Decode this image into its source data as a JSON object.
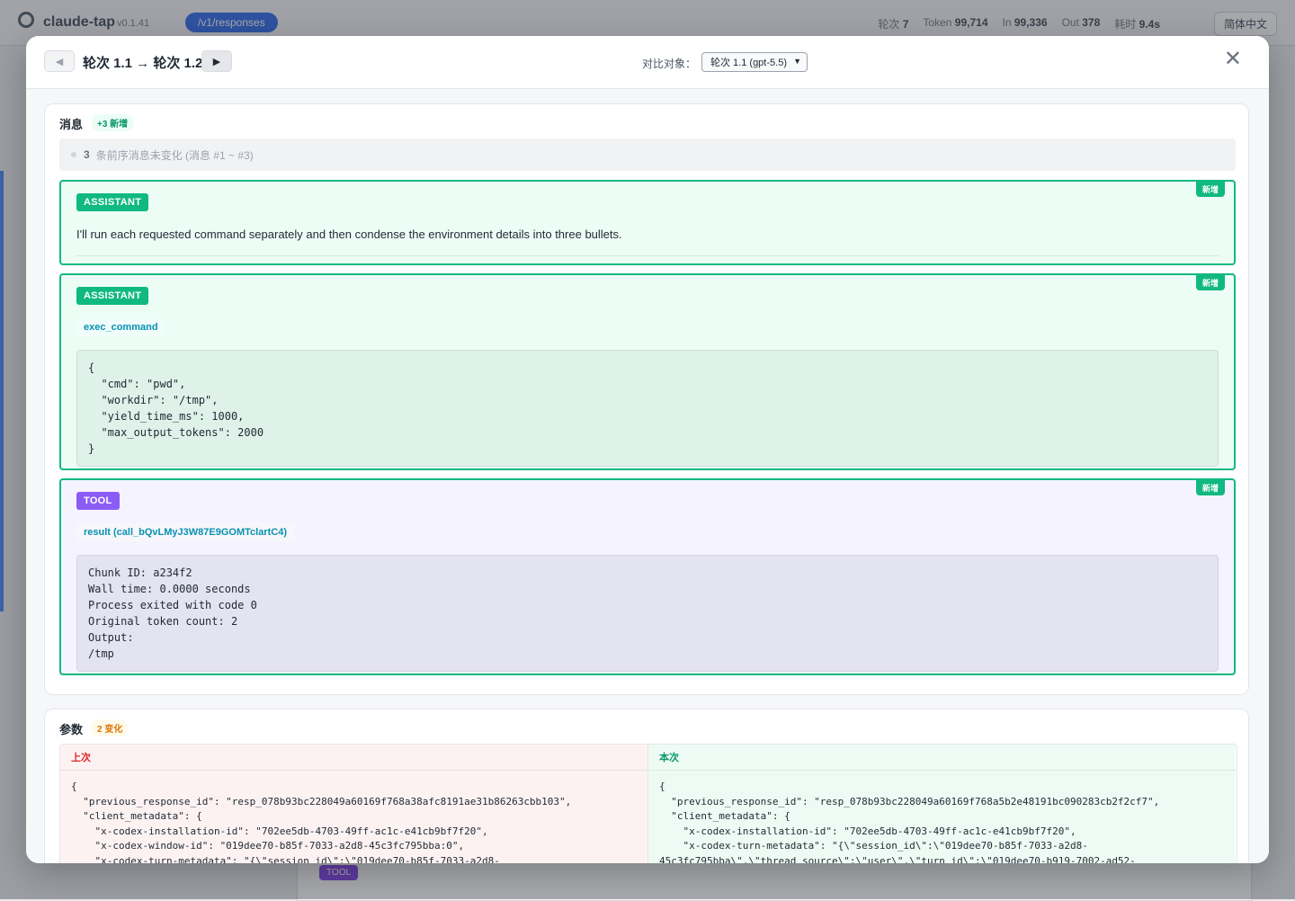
{
  "background": {
    "app_name": "claude-tap",
    "version": "v0.1.41",
    "endpoint_pill": "/v1/responses",
    "stats": [
      {
        "label": "轮次",
        "value": "7"
      },
      {
        "label": "Token",
        "value": "99,714"
      },
      {
        "label": "In",
        "value": "99,336"
      },
      {
        "label": "Out",
        "value": "378"
      },
      {
        "label": "耗时",
        "value": "9.4s"
      }
    ],
    "language": "简体中文",
    "tool_chip": "TOOL"
  },
  "modal": {
    "round_title": "轮次 1.1 → 轮次 1.2",
    "compare_label": "对比对象：",
    "compare_value": "轮次 1.1 (gpt-5.5)",
    "close_symbol": "✕",
    "prev_symbol": "◀",
    "next_symbol": "▶"
  },
  "messages": {
    "title": "消息",
    "badge": "+3 新增",
    "collapsed": {
      "count": "3",
      "text": "条前序消息未变化 (消息 #1 ~ #3)"
    },
    "new_tag": "新增",
    "items": [
      {
        "role": "ASSISTANT",
        "text": "I'll run each requested command separately and then condense the environment details into three bullets."
      },
      {
        "role": "ASSISTANT",
        "function": "exec_command",
        "code": "{\n  \"cmd\": \"pwd\",\n  \"workdir\": \"/tmp\",\n  \"yield_time_ms\": 1000,\n  \"max_output_tokens\": 2000\n}"
      },
      {
        "role": "TOOL",
        "function": "result (call_bQvLMyJ3W87E9GOMTclartC4)",
        "code": "Chunk ID: a234f2\nWall time: 0.0000 seconds\nProcess exited with code 0\nOriginal token count: 2\nOutput:\n/tmp"
      }
    ]
  },
  "params": {
    "title": "参数",
    "badge": "2 变化",
    "left_label": "上次",
    "right_label": "本次",
    "left_code": "{\n  \"previous_response_id\": \"resp_078b93bc228049a60169f768a38afc8191ae31b86263cbb103\",\n  \"client_metadata\": {\n    \"x-codex-installation-id\": \"702ee5db-4703-49ff-ac1c-e41cb9bf7f20\",\n    \"x-codex-window-id\": \"019dee70-b85f-7033-a2d8-45c3fc795bba:0\",\n    \"x-codex-turn-metadata\": \"{\\\"session_id\\\":\\\"019dee70-b85f-7033-a2d8-",
    "right_code": "{\n  \"previous_response_id\": \"resp_078b93bc228049a60169f768a5b2e48191bc090283cb2f2cf7\",\n  \"client_metadata\": {\n    \"x-codex-installation-id\": \"702ee5db-4703-49ff-ac1c-e41cb9bf7f20\",\n    \"x-codex-turn-metadata\": \"{\\\"session_id\\\":\\\"019dee70-b85f-7033-a2d8-\n45c3fc795bba\\\",\\\"thread_source\\\":\\\"user\\\",\\\"turn_id\\\":\\\"019dee70-b919-7002-ad52-"
  },
  "colors": {
    "added_border": "#10b981",
    "assistant_chip": "#10b981",
    "tool_chip": "#8b5cf6",
    "function_text": "#0891b2",
    "removed_text": "#dc2626"
  }
}
